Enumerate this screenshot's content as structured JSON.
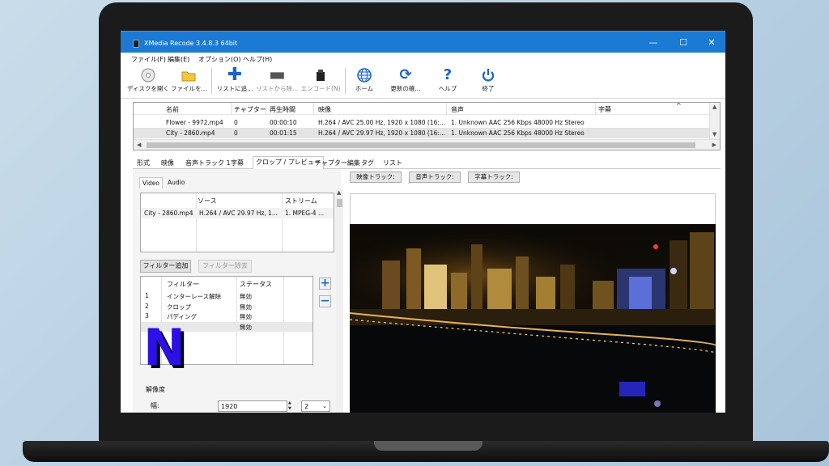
{
  "window": {
    "title": "XMedia Recode 3.4.8.3 64bit",
    "minimize": "—",
    "maximize": "☐",
    "close": "✕"
  },
  "menu": [
    "ファイル(F)",
    "編集(E)",
    "オプション(O)",
    "ヘルプ(H)"
  ],
  "toolbar": {
    "open_disc": "ディスクを開く",
    "open_file": "ファイルを...",
    "add_to_list": "リストに追...",
    "remove_from_list": "リストから除...",
    "encode": "エンコード(N)",
    "home": "ホーム",
    "check_update": "更新の確...",
    "help": "ヘルプ",
    "exit": "終了"
  },
  "file_list": {
    "columns": [
      "名前",
      "チャプター",
      "再生時間",
      "映像",
      "音声",
      "字幕"
    ],
    "rows": [
      [
        "Flower - 9972.mp4",
        "0",
        "00:00:10",
        "H.264 / AVC  25.00 Hz, 1920 x 1080 (16:...",
        "1. Unknown AAC  256 Kbps 48000 Hz Stereo",
        ""
      ],
      [
        "City - 2860.mp4",
        "0",
        "00:01:15",
        "H.264 / AVC  29.97 Hz, 1920 x 1080 (16:...",
        "1. Unknown AAC  256 Kbps 48000 Hz Stereo",
        ""
      ]
    ]
  },
  "tabs": [
    "形式",
    "映像",
    "音声トラック 1",
    "字幕",
    "クロップ / プレビュー",
    "チャプター編集",
    "タグ",
    "リスト"
  ],
  "active_tab": "クロップ / プレビュー",
  "subtabs": [
    "Video",
    "Audio"
  ],
  "source_table": {
    "columns": [
      "",
      "ソース",
      "ストリーム"
    ],
    "row": [
      "City - 2860.mp4",
      "H.264 / AVC  29.97 Hz, 1...",
      "1. MPEG-4 ..."
    ]
  },
  "buttons": {
    "add_filter": "フィルター追加",
    "remove_filter": "フィルター除去",
    "plus": "+",
    "minus": "−"
  },
  "filter_table": {
    "columns": [
      "",
      "フィルター",
      "ステータス"
    ],
    "rows": [
      [
        "1",
        "インターレース解除",
        "無効"
      ],
      [
        "2",
        "クロップ",
        "無効"
      ],
      [
        "3",
        "パディング",
        "無効"
      ],
      [
        "",
        "",
        "無効"
      ]
    ]
  },
  "logo_letter": "N",
  "resolution": {
    "section": "解像度",
    "width_label": "幅:",
    "width_value": "1920",
    "divisor": "2"
  },
  "track_buttons": [
    "映像トラック:",
    "音声トラック:",
    "字幕トラック:"
  ],
  "colors": {
    "titlebar": "#1a7ad4",
    "accent_blue": "#1a63c9",
    "logo": "#2d10e6"
  }
}
